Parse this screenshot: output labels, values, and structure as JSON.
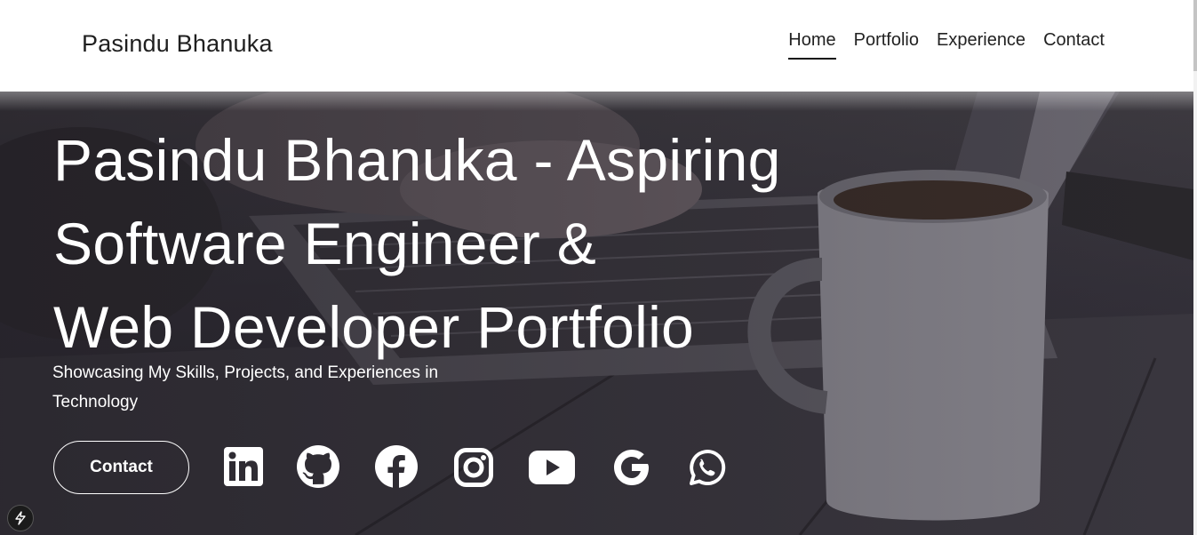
{
  "header": {
    "brand": "Pasindu Bhanuka",
    "nav": [
      {
        "label": "Home",
        "active": true
      },
      {
        "label": "Portfolio",
        "active": false
      },
      {
        "label": "Experience",
        "active": false
      },
      {
        "label": "Contact",
        "active": false
      }
    ]
  },
  "hero": {
    "title_lines": [
      "Pasindu Bhanuka - Aspiring",
      "Software Engineer &",
      "Web Developer Portfolio"
    ],
    "subtitle": "Showcasing My Skills, Projects, and Experiences in Technology",
    "contact_button": "Contact",
    "social_icons": [
      "linkedin-icon",
      "github-icon",
      "facebook-icon",
      "instagram-icon",
      "youtube-icon",
      "google-icon",
      "whatsapp-icon"
    ]
  },
  "colors": {
    "header_bg": "#ffffff",
    "hero_overlay": "#2e2b33",
    "text_light": "#ffffff",
    "nav_text": "#222222"
  }
}
